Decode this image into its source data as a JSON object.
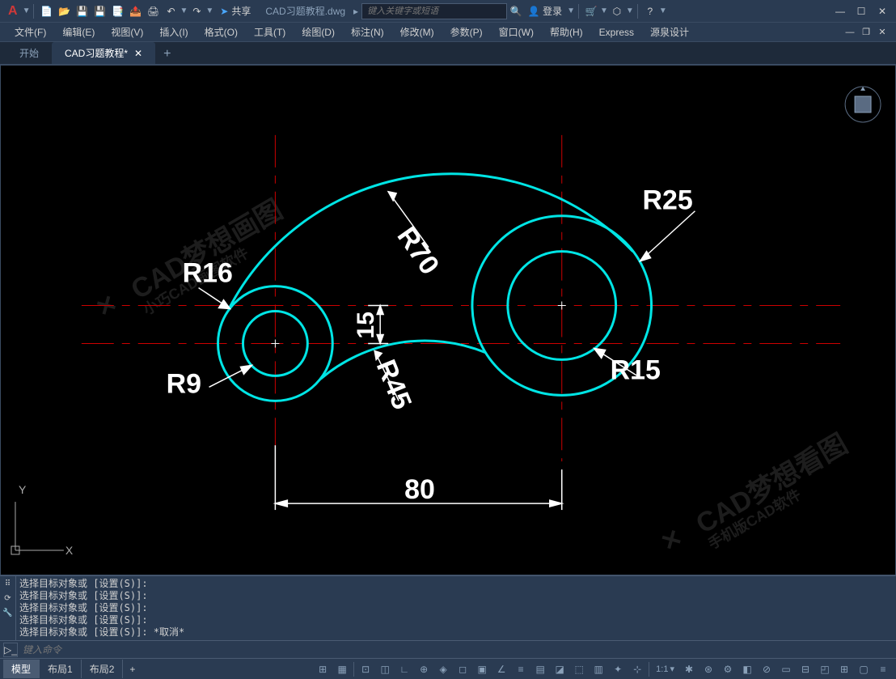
{
  "titlebar": {
    "share_label": "共享",
    "filename": "CAD习题教程.dwg",
    "search_placeholder": "键入关键字或短语",
    "login_label": "登录"
  },
  "menubar": {
    "items": [
      "文件(F)",
      "编辑(E)",
      "视图(V)",
      "插入(I)",
      "格式(O)",
      "工具(T)",
      "绘图(D)",
      "标注(N)",
      "修改(M)",
      "参数(P)",
      "窗口(W)",
      "帮助(H)",
      "Express",
      "源泉设计"
    ]
  },
  "tabs": {
    "items": [
      {
        "label": "开始",
        "active": false
      },
      {
        "label": "CAD习题教程*",
        "active": true
      }
    ]
  },
  "drawing": {
    "dims": {
      "r70": "R70",
      "r25": "R25",
      "r16": "R16",
      "r9": "R9",
      "r45": "R45",
      "r15": "R15",
      "d15": "15",
      "d80": "80"
    },
    "axis": {
      "y": "Y",
      "x": "X"
    }
  },
  "cmd": {
    "log": [
      "选择目标对象或 [设置(S)]:",
      "选择目标对象或 [设置(S)]:",
      "选择目标对象或 [设置(S)]:",
      "选择目标对象或 [设置(S)]:",
      "选择目标对象或 [设置(S)]: *取消*"
    ],
    "input_placeholder": "键入命令"
  },
  "statusbar": {
    "layouts": [
      {
        "label": "模型",
        "active": true
      },
      {
        "label": "布局1",
        "active": false
      },
      {
        "label": "布局2",
        "active": false
      }
    ],
    "scale": "1:1"
  },
  "chart_data": {
    "type": "cad_drawing",
    "description": "2D mechanical part with arcs and circles",
    "circles": [
      {
        "center": "left",
        "radii": [
          16,
          9
        ]
      },
      {
        "center": "right",
        "radii": [
          25,
          15
        ]
      }
    ],
    "arcs": [
      {
        "radius": 70,
        "role": "top-outer"
      },
      {
        "radius": 45,
        "role": "bottom-concave"
      }
    ],
    "linear_dims": [
      {
        "value": 80,
        "direction": "horizontal",
        "between": "circle-centers"
      },
      {
        "value": 15,
        "direction": "vertical",
        "between": "center-levels"
      }
    ]
  }
}
